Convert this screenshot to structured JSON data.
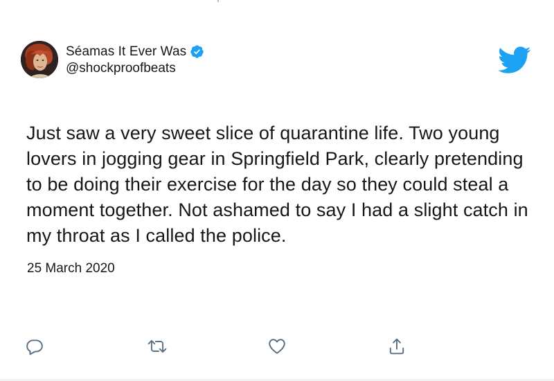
{
  "user": {
    "display_name": "Séamas It Ever Was",
    "handle": "@shockproofbeats",
    "verified": true
  },
  "tweet": {
    "text": "Just saw a very sweet slice of quarantine life. Two young lovers in jogging gear in Springfield Park, clearly pretending to be doing their exercise for the day so they could steal a moment together. Not ashamed to say I had a slight catch in my throat as I called the police.",
    "date": "25 March 2020"
  },
  "icons": {
    "brand": "twitter-bird-icon",
    "verified": "verified-badge-icon",
    "reply": "reply-icon",
    "retweet": "retweet-icon",
    "like": "heart-icon",
    "share": "share-icon"
  },
  "colors": {
    "brand_blue": "#1da1f2",
    "action_gray": "#5b7083",
    "text": "#14171a"
  }
}
